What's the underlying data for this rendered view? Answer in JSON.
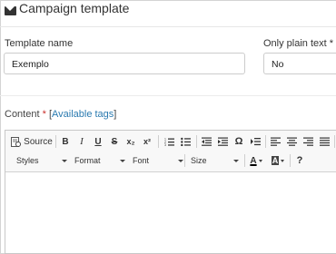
{
  "header": {
    "title": "Campaign template",
    "icon": "envelope-icon"
  },
  "fields": {
    "template_name": {
      "label": "Template name",
      "value": "Exemplo"
    },
    "plain_text": {
      "label": "Only plain text *",
      "value": "No"
    }
  },
  "content": {
    "label": "Content",
    "required_mark": "*",
    "tags_open": "[",
    "tags_link": "Available tags",
    "tags_close": "]"
  },
  "toolbar": {
    "source_label": "Source",
    "bold": "B",
    "italic": "I",
    "underline": "U",
    "strike": "S",
    "subscript": "x₂",
    "superscript": "x²",
    "special_char": "Ω",
    "styles": "Styles",
    "format": "Format",
    "font": "Font",
    "size": "Size",
    "text_color": "A",
    "bg_color": "A",
    "help": "?"
  },
  "colors": {
    "link": "#2a7ab0",
    "required": "#c9302c"
  }
}
